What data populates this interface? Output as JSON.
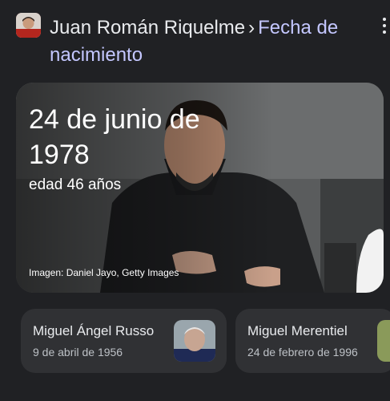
{
  "header": {
    "name": "Juan Román Riquelme",
    "separator": "›",
    "attribute": "Fecha de nacimiento"
  },
  "hero": {
    "date": "24 de junio de 1978",
    "age": "edad 46 años",
    "credit": "Imagen: Daniel Jayo, Getty Images"
  },
  "related": [
    {
      "name": "Miguel Ángel Russo",
      "date": "9 de abril de 1956"
    },
    {
      "name": "Miguel Merentiel",
      "date": "24 de febrero de 1996"
    }
  ],
  "icons": {
    "menu": "more-vert-icon"
  }
}
